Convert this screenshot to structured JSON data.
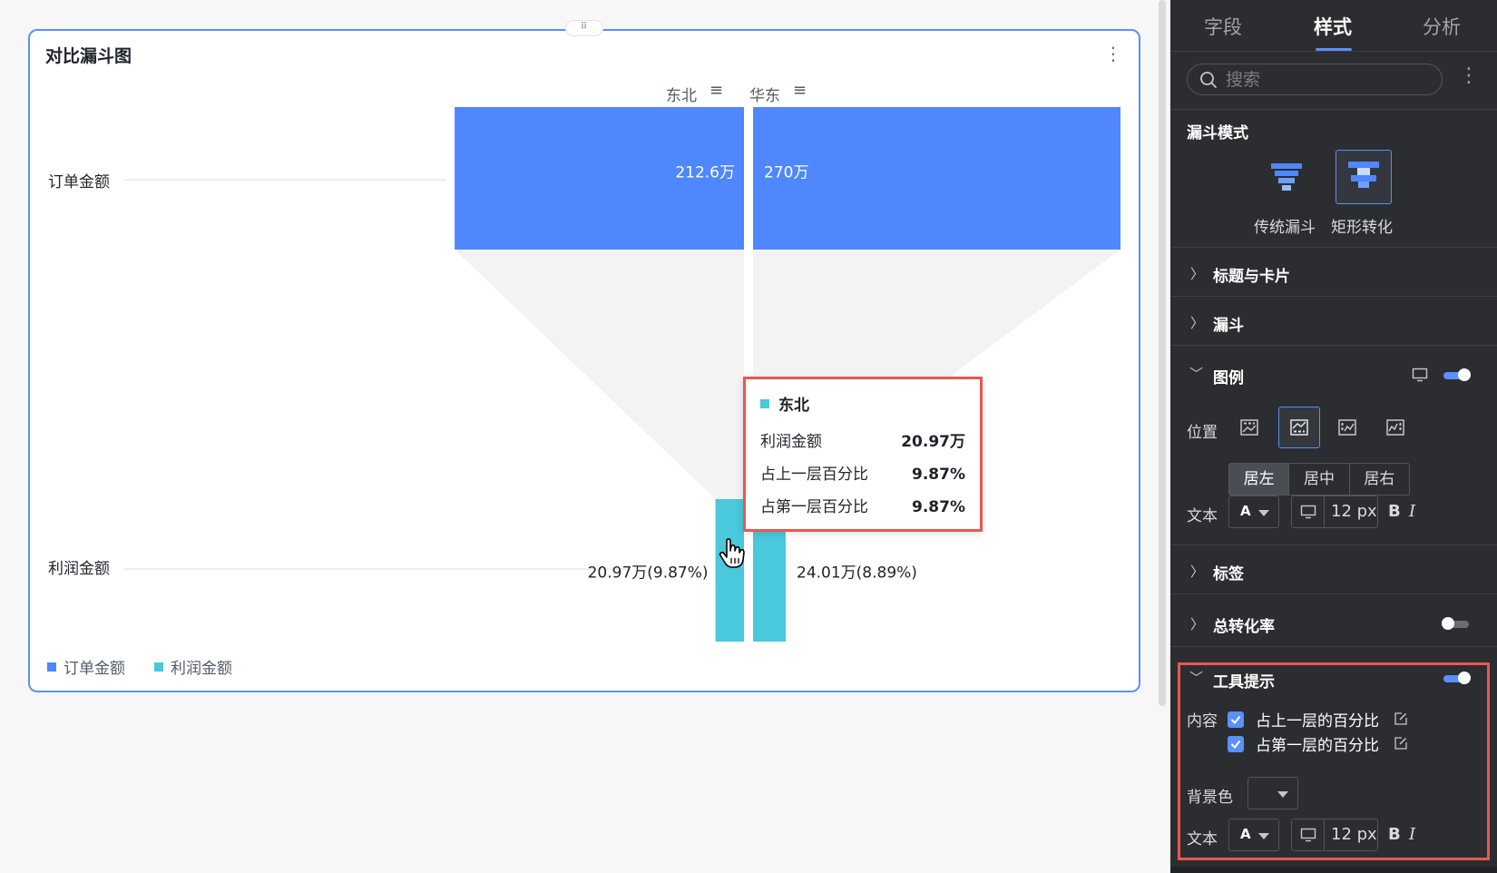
{
  "card": {
    "title": "对比漏斗图",
    "drag_handle": "⠿",
    "more": "⋮"
  },
  "chart_data": {
    "type": "funnel",
    "mode": "矩形转化",
    "groups": [
      "东北",
      "华东"
    ],
    "stages": [
      "订单金额",
      "利润金额"
    ],
    "series": [
      {
        "name": "订单金额",
        "values": [
          212.6,
          270
        ],
        "labels": [
          "212.6万",
          "270万"
        ],
        "color": "#4e87ff"
      },
      {
        "name": "利润金额",
        "values": [
          20.97,
          24.01
        ],
        "labels": [
          "20.97万(9.87%)",
          "24.01万(8.89%)"
        ],
        "color": "#4ac8dc"
      }
    ],
    "unit": "万",
    "legend": "bottom-left",
    "legend_entries": [
      "订单金额",
      "利润金额"
    ]
  },
  "tooltip": {
    "title": "东北",
    "color": "#4ac8dc",
    "rows": [
      {
        "label": "利润金额",
        "value": "20.97万"
      },
      {
        "label": "占上一层百分比",
        "value": "9.87%"
      },
      {
        "label": "占第一层百分比",
        "value": "9.87%"
      }
    ]
  },
  "panel": {
    "tabs": [
      "字段",
      "样式",
      "分析"
    ],
    "active_tab": "样式",
    "search_placeholder": "搜索",
    "funnel_mode": {
      "title": "漏斗模式",
      "options": [
        "传统漏斗",
        "矩形转化"
      ],
      "selected": "矩形转化"
    },
    "sections": {
      "title_card": "标题与卡片",
      "funnel": "漏斗",
      "legend": "图例",
      "labels": "标签",
      "total_rate": "总转化率",
      "tooltip": "工具提示"
    },
    "legend": {
      "enabled": true,
      "position_label": "位置",
      "align": [
        "居左",
        "居中",
        "居右"
      ],
      "align_selected": "居左",
      "text_label": "文本",
      "font_color_glyph": "A",
      "font_size": "12 px",
      "bold": "B",
      "italic": "I"
    },
    "total_rate_enabled": false,
    "tooltip_settings": {
      "enabled": true,
      "content_label": "内容",
      "content_items": [
        "占上一层的百分比",
        "占第一层的百分比"
      ],
      "bg_label": "背景色",
      "text_label": "文本",
      "font_color_glyph": "A",
      "font_size": "12 px",
      "bold": "B",
      "italic": "I"
    }
  }
}
